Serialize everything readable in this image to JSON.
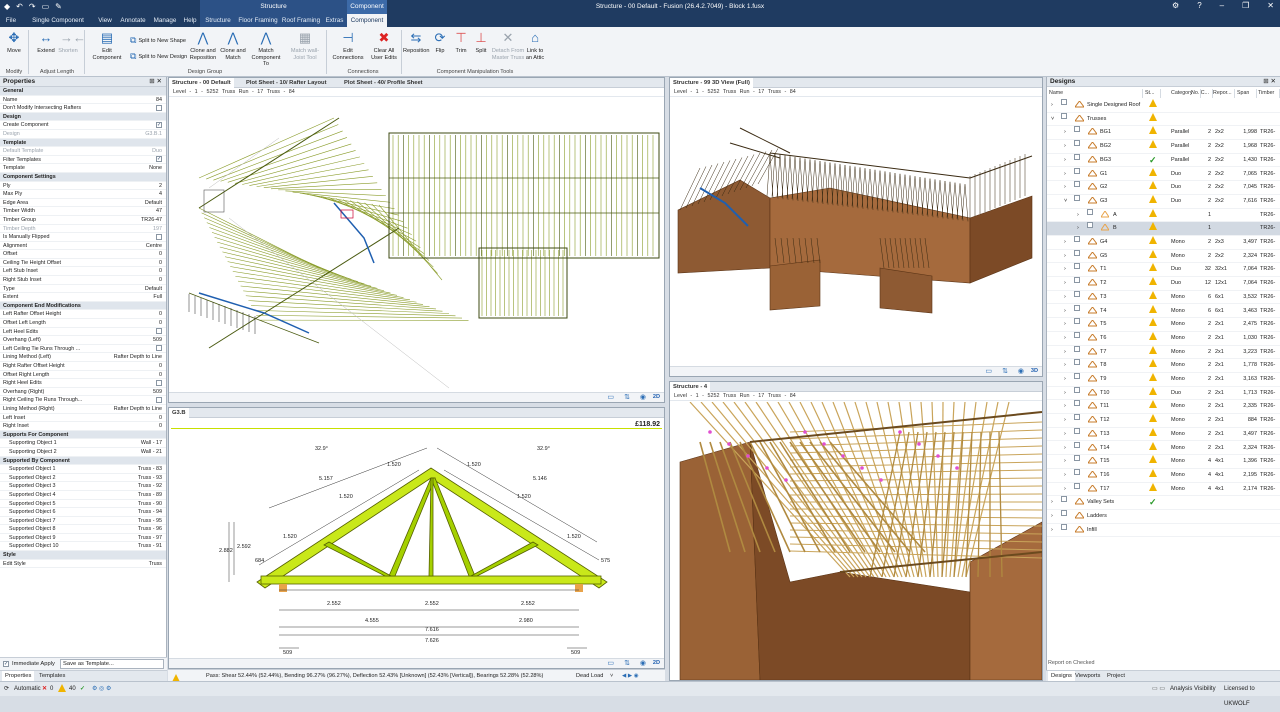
{
  "titlebar": {
    "title": "Structure - 00 Default - Fusion (26.4.2.7049) - Block 1.fusx",
    "context_group": "Structure",
    "context_sub": "Component"
  },
  "tabs": [
    "File",
    "Single Component Design",
    "View",
    "Annotate",
    "Manage",
    "Help",
    "Structure",
    "Floor Framing",
    "Roof Framing",
    "Extras",
    "Component"
  ],
  "ribbon": {
    "move": "Move",
    "extend": "Extend",
    "shorten": "Shorten",
    "edit_component": "Edit Component",
    "split_new_shape": "Split to New Shape",
    "split_new_design": "Split to New Design",
    "clone_reposition": "Clone and Reposition",
    "clone_match": "Clone and Match",
    "match_component": "Match Component To",
    "match_wall_joist": "Match wall-Joist Tool",
    "edit_connections": "Edit Connections",
    "clear_user_edits": "Clear All User Edits",
    "reposition": "Reposition",
    "flip": "Flip",
    "trim": "Trim",
    "split": "Split",
    "detach": "Detach From Master Truss",
    "link_attic": "Link to an Attic",
    "groups": {
      "modify": "Modify",
      "adjust_length": "Adjust Length",
      "design_group": "Design Group",
      "connections": "Connections",
      "manipulation": "Component Manipulation Tools"
    }
  },
  "properties": {
    "title": "Properties",
    "rows": [
      {
        "t": "sec",
        "l": "General"
      },
      {
        "l": "Name",
        "v": "84"
      },
      {
        "l": "Don't Modify Intersecting Rafters",
        "cb": ""
      },
      {
        "t": "sec",
        "l": "Design"
      },
      {
        "l": "Create Component",
        "cb": "✓"
      },
      {
        "l": "Design",
        "v": "G3.B.1",
        "dim": true
      },
      {
        "t": "sec",
        "l": "Template"
      },
      {
        "l": "Default Template",
        "v": "Duo",
        "dim": true
      },
      {
        "l": "Filter Templates",
        "cb": "✓"
      },
      {
        "l": "Template",
        "v": "None"
      },
      {
        "t": "sec",
        "l": "Component Settings"
      },
      {
        "l": "Ply",
        "v": "2"
      },
      {
        "l": "Max Ply",
        "v": "4"
      },
      {
        "l": "Edge Area",
        "v": "Default"
      },
      {
        "l": "Timber Width",
        "v": "47"
      },
      {
        "l": "Timber Group",
        "v": "TR26-47"
      },
      {
        "l": "Timber Depth",
        "v": "197",
        "dim": true
      },
      {
        "l": "Is Manually Flipped",
        "cb": ""
      },
      {
        "l": "Alignment",
        "v": "Centre"
      },
      {
        "l": "Offset",
        "v": "0"
      },
      {
        "l": "Ceiling Tie Height Offset",
        "v": "0"
      },
      {
        "l": "Left Stub Inset",
        "v": "0"
      },
      {
        "l": "Right Stub Inset",
        "v": "0"
      },
      {
        "l": "Type",
        "v": "Default"
      },
      {
        "l": "Extent",
        "v": "Full"
      },
      {
        "t": "sec",
        "l": "Component End Modifications"
      },
      {
        "l": "Left Rafter Offset Height",
        "v": "0"
      },
      {
        "l": "Offset Left Length",
        "v": "0"
      },
      {
        "l": "Left Heel Edits",
        "cb": ""
      },
      {
        "l": "Overhang (Left)",
        "v": "509"
      },
      {
        "l": "Left Ceiling Tie Runs Through ...",
        "cb": ""
      },
      {
        "l": "Lining Method (Left)",
        "v": "Rafter Depth to Line"
      },
      {
        "l": "Right Rafter Offset Height",
        "v": "0"
      },
      {
        "l": "Offset Right Length",
        "v": "0"
      },
      {
        "l": "Right Heel Edits",
        "cb": ""
      },
      {
        "l": "Overhang (Right)",
        "v": "509"
      },
      {
        "l": "Right Ceiling Tie Runs Through...",
        "cb": ""
      },
      {
        "l": "Lining Method (Right)",
        "v": "Rafter Depth to Line"
      },
      {
        "l": "Left Inset",
        "v": "0"
      },
      {
        "l": "Right Inset",
        "v": "0"
      },
      {
        "t": "sec",
        "l": "Supports For Component"
      },
      {
        "l": "Supporting Object 1",
        "v": "Wall - 17",
        "ind": true
      },
      {
        "l": "Supporting Object 2",
        "v": "Wall - 21",
        "ind": true
      },
      {
        "t": "sec",
        "l": "Supported By Component"
      },
      {
        "l": "Supported Object 1",
        "v": "Truss - 83",
        "ind": true
      },
      {
        "l": "Supported Object 2",
        "v": "Truss - 93",
        "ind": true
      },
      {
        "l": "Supported Object 3",
        "v": "Truss - 92",
        "ind": true
      },
      {
        "l": "Supported Object 4",
        "v": "Truss - 89",
        "ind": true
      },
      {
        "l": "Supported Object 5",
        "v": "Truss - 90",
        "ind": true
      },
      {
        "l": "Supported Object 6",
        "v": "Truss - 94",
        "ind": true
      },
      {
        "l": "Supported Object 7",
        "v": "Truss - 95",
        "ind": true
      },
      {
        "l": "Supported Object 8",
        "v": "Truss - 96",
        "ind": true
      },
      {
        "l": "Supported Object 9",
        "v": "Truss - 97",
        "ind": true
      },
      {
        "l": "Supported Object 10",
        "v": "Truss - 91",
        "ind": true
      },
      {
        "t": "sec",
        "l": "Style"
      },
      {
        "l": "Edit Style",
        "v": "Truss"
      }
    ],
    "immediate_apply": "Immediate Apply",
    "save_template": "Save as Template...",
    "tabs": [
      "Properties",
      "Templates"
    ]
  },
  "views": {
    "tl": {
      "tabs": [
        "Structure - 00 Default",
        "Plot Sheet - 10/ Rafter Layout",
        "Plot Sheet - 40/ Profile Sheet"
      ],
      "crumb": "Level - 1 - 5252   Truss Run - 17   Truss - 84",
      "mode": "2D"
    },
    "tr": {
      "tab": "Structure - 99 3D View (Full)",
      "crumb": "Level - 1 - 5252   Truss Run - 17   Truss - 84",
      "mode": "3D"
    },
    "bl": {
      "tab": "G3.B",
      "price": "£118.92",
      "mode": "2D",
      "dims": {
        "pitch_l": "32.9°",
        "pitch_r": "32.9°",
        "top_l": "1.520",
        "top_r": "1.520",
        "mid_l": "1.520",
        "mid_r": "1.520",
        "long_l": "5.157",
        "long_r": "5.146",
        "rise": "2.882",
        "rise2": "2.592",
        "end_l": "684",
        "end_r": "575",
        "b1": "2.552",
        "b2": "2.552",
        "b3": "2.552",
        "c1": "4.555",
        "c2": "2.980",
        "d1": "7.616",
        "d2": "7.626",
        "oh_l": "509",
        "oh_r": "509"
      }
    },
    "br": {
      "tab": "Structure - 4",
      "crumb": "Level - 1 - 5252   Truss Run - 17   Truss - 84"
    }
  },
  "analysis": {
    "text": "Pass: Shear 52.44% (52.44%), Bending 96.27% (96.27%), Deflection 52.43% [Unknown] (52.43% [Vertical]), Bearings 52.28% (52.28%)",
    "load": "Dead Load"
  },
  "designs": {
    "title": "Designs",
    "columns": [
      "Name",
      "St...",
      "Category",
      "No. C...",
      "Repor...",
      "Span",
      "Timber"
    ],
    "rows": [
      {
        "name": "Single Designed Roof",
        "lvl": 0,
        "st": "warn",
        "cat": "",
        "n": "",
        "rep": "",
        "span": "",
        "tim": "",
        "exp": "›"
      },
      {
        "name": "Trusses",
        "lvl": 0,
        "st": "warn",
        "cat": "",
        "n": "",
        "rep": "",
        "span": "",
        "tim": "",
        "exp": "˅"
      },
      {
        "name": "BG1",
        "lvl": 1,
        "st": "warn",
        "cat": "Parallel",
        "n": "2",
        "rep": "2x2",
        "span": "1,998",
        "tim": "TR26-",
        "exp": "›"
      },
      {
        "name": "BG2",
        "lvl": 1,
        "st": "warn",
        "cat": "Parallel",
        "n": "2",
        "rep": "2x2",
        "span": "1,968",
        "tim": "TR26-",
        "exp": "›"
      },
      {
        "name": "BG3",
        "lvl": 1,
        "st": "ok",
        "cat": "Parallel",
        "n": "2",
        "rep": "2x2",
        "span": "1,430",
        "tim": "TR26-",
        "exp": "›"
      },
      {
        "name": "G1",
        "lvl": 1,
        "st": "warn",
        "cat": "Duo",
        "n": "2",
        "rep": "2x2",
        "span": "7,065",
        "tim": "TR26-",
        "exp": "›"
      },
      {
        "name": "G2",
        "lvl": 1,
        "st": "warn",
        "cat": "Duo",
        "n": "2",
        "rep": "2x2",
        "span": "7,045",
        "tim": "TR26-",
        "exp": "›"
      },
      {
        "name": "G3",
        "lvl": 1,
        "st": "warn",
        "cat": "Duo",
        "n": "2",
        "rep": "2x2",
        "span": "7,616",
        "tim": "TR26-",
        "exp": "˅"
      },
      {
        "name": "A",
        "lvl": 2,
        "st": "warn",
        "cat": "",
        "n": "1",
        "rep": "",
        "span": "",
        "tim": "TR26-",
        "exp": "›"
      },
      {
        "name": "B",
        "lvl": 2,
        "st": "warn",
        "cat": "",
        "n": "1",
        "rep": "",
        "span": "",
        "tim": "TR26-",
        "exp": "›",
        "sel": true
      },
      {
        "name": "G4",
        "lvl": 1,
        "st": "warn",
        "cat": "Mono",
        "n": "2",
        "rep": "2x3",
        "span": "3,497",
        "tim": "TR26-",
        "exp": "›"
      },
      {
        "name": "G5",
        "lvl": 1,
        "st": "warn",
        "cat": "Mono",
        "n": "2",
        "rep": "2x2",
        "span": "2,324",
        "tim": "TR26-",
        "exp": "›"
      },
      {
        "name": "T1",
        "lvl": 1,
        "st": "warn",
        "cat": "Duo",
        "n": "32",
        "rep": "32x1",
        "span": "7,064",
        "tim": "TR26-",
        "exp": "›"
      },
      {
        "name": "T2",
        "lvl": 1,
        "st": "warn",
        "cat": "Duo",
        "n": "12",
        "rep": "12x1",
        "span": "7,064",
        "tim": "TR26-",
        "exp": "›"
      },
      {
        "name": "T3",
        "lvl": 1,
        "st": "warn",
        "cat": "Mono",
        "n": "6",
        "rep": "6x1",
        "span": "3,532",
        "tim": "TR26-",
        "exp": "›"
      },
      {
        "name": "T4",
        "lvl": 1,
        "st": "warn",
        "cat": "Mono",
        "n": "6",
        "rep": "6x1",
        "span": "3,463",
        "tim": "TR26-",
        "exp": "›"
      },
      {
        "name": "T5",
        "lvl": 1,
        "st": "warn",
        "cat": "Mono",
        "n": "2",
        "rep": "2x1",
        "span": "2,475",
        "tim": "TR26-",
        "exp": "›"
      },
      {
        "name": "T6",
        "lvl": 1,
        "st": "warn",
        "cat": "Mono",
        "n": "2",
        "rep": "2x1",
        "span": "1,030",
        "tim": "TR26-",
        "exp": "›"
      },
      {
        "name": "T7",
        "lvl": 1,
        "st": "warn",
        "cat": "Mono",
        "n": "2",
        "rep": "2x1",
        "span": "3,223",
        "tim": "TR26-",
        "exp": "›"
      },
      {
        "name": "T8",
        "lvl": 1,
        "st": "warn",
        "cat": "Mono",
        "n": "2",
        "rep": "2x1",
        "span": "1,778",
        "tim": "TR26-",
        "exp": "›"
      },
      {
        "name": "T9",
        "lvl": 1,
        "st": "warn",
        "cat": "Mono",
        "n": "2",
        "rep": "2x1",
        "span": "3,163",
        "tim": "TR26-",
        "exp": "›"
      },
      {
        "name": "T10",
        "lvl": 1,
        "st": "warn",
        "cat": "Duo",
        "n": "2",
        "rep": "2x1",
        "span": "1,713",
        "tim": "TR26-",
        "exp": "›"
      },
      {
        "name": "T11",
        "lvl": 1,
        "st": "warn",
        "cat": "Mono",
        "n": "2",
        "rep": "2x1",
        "span": "2,335",
        "tim": "TR26-",
        "exp": "›"
      },
      {
        "name": "T12",
        "lvl": 1,
        "st": "warn",
        "cat": "Mono",
        "n": "2",
        "rep": "2x1",
        "span": "884",
        "tim": "TR26-",
        "exp": "›"
      },
      {
        "name": "T13",
        "lvl": 1,
        "st": "warn",
        "cat": "Mono",
        "n": "2",
        "rep": "2x1",
        "span": "3,497",
        "tim": "TR26-",
        "exp": "›"
      },
      {
        "name": "T14",
        "lvl": 1,
        "st": "warn",
        "cat": "Mono",
        "n": "2",
        "rep": "2x1",
        "span": "2,324",
        "tim": "TR26-",
        "exp": "›"
      },
      {
        "name": "T15",
        "lvl": 1,
        "st": "warn",
        "cat": "Mono",
        "n": "4",
        "rep": "4x1",
        "span": "1,396",
        "tim": "TR26-",
        "exp": "›"
      },
      {
        "name": "T16",
        "lvl": 1,
        "st": "warn",
        "cat": "Mono",
        "n": "4",
        "rep": "4x1",
        "span": "2,195",
        "tim": "TR26-",
        "exp": "›"
      },
      {
        "name": "T17",
        "lvl": 1,
        "st": "warn",
        "cat": "Mono",
        "n": "4",
        "rep": "4x1",
        "span": "2,174",
        "tim": "TR26-",
        "exp": "›"
      },
      {
        "name": "Valley Sets",
        "lvl": 0,
        "st": "ok",
        "cat": "",
        "n": "",
        "rep": "",
        "span": "",
        "tim": "",
        "exp": "›"
      },
      {
        "name": "Ladders",
        "lvl": 0,
        "st": "",
        "cat": "",
        "n": "",
        "rep": "",
        "span": "",
        "tim": "",
        "exp": "›"
      },
      {
        "name": "Infill",
        "lvl": 0,
        "st": "",
        "cat": "",
        "n": "",
        "rep": "",
        "span": "",
        "tim": "",
        "exp": "›"
      }
    ],
    "report": "Report on Checked",
    "tabs": [
      "Designs",
      "Viewports",
      "Project"
    ]
  },
  "status": {
    "mode": "Automatic",
    "errors": "0",
    "passes": "40",
    "right1": "Analysis Visibility",
    "right2": "Licensed to UKWOLF"
  },
  "colors": {
    "accent": "#1f3b61",
    "truss": "#b5d40e",
    "warn": "#f0b400",
    "ok": "#2b9a2b"
  }
}
